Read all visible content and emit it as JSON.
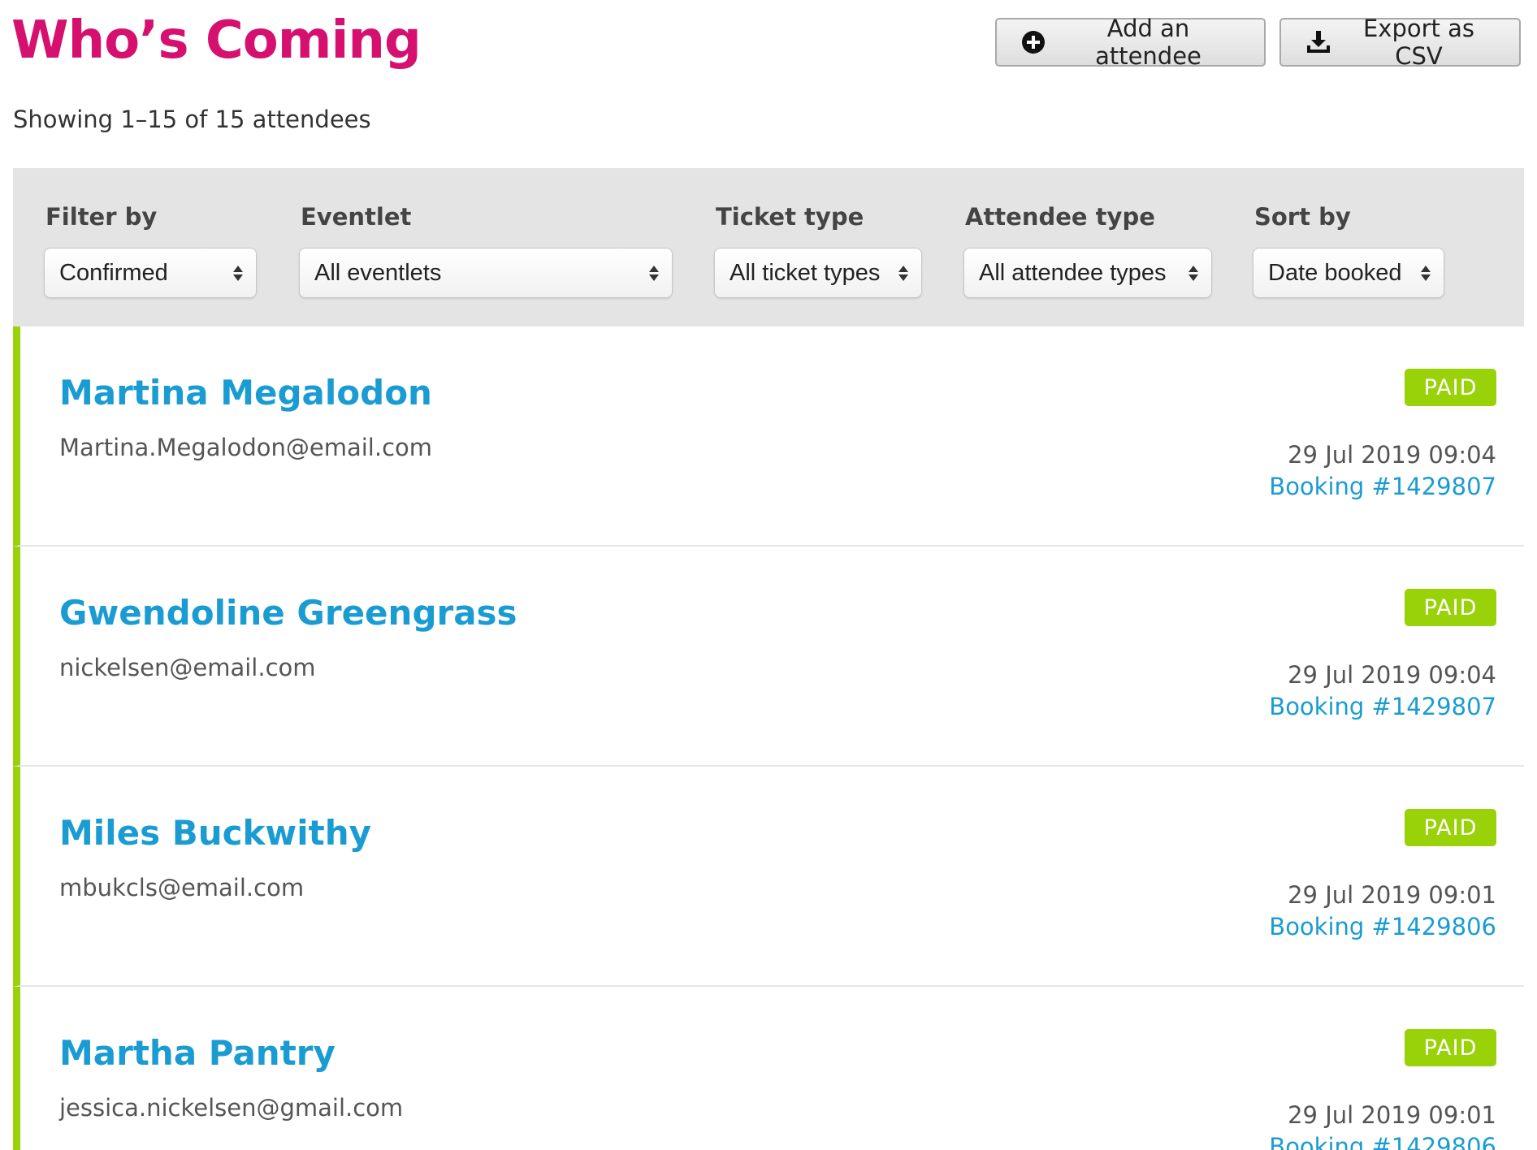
{
  "header": {
    "title": "Who’s Coming",
    "add_attendee_label": "Add an attendee",
    "export_csv_label": "Export as CSV",
    "add_icon": "plus-circle-icon",
    "export_icon": "download-icon"
  },
  "summary": {
    "showing_text": "Showing 1–15 of 15 attendees"
  },
  "filters": {
    "filter_by": {
      "label": "Filter by",
      "value": "Confirmed"
    },
    "eventlet": {
      "label": "Eventlet",
      "value": "All eventlets"
    },
    "ticket_type": {
      "label": "Ticket type",
      "value": "All ticket types"
    },
    "attendee_type": {
      "label": "Attendee type",
      "value": "All attendee types"
    },
    "sort_by": {
      "label": "Sort by",
      "value": "Date booked"
    }
  },
  "attendees": [
    {
      "name": "Martina Megalodon",
      "email": "Martina.Megalodon@email.com",
      "status": "PAID",
      "date": "29 Jul 2019 09:04",
      "booking": "Booking #1429807"
    },
    {
      "name": "Gwendoline Greengrass",
      "email": "nickelsen@email.com",
      "status": "PAID",
      "date": "29 Jul 2019 09:04",
      "booking": "Booking #1429807"
    },
    {
      "name": "Miles Buckwithy",
      "email": "mbukcls@email.com",
      "status": "PAID",
      "date": "29 Jul 2019 09:01",
      "booking": "Booking #1429806"
    },
    {
      "name": "Martha Pantry",
      "email": "jessica.nickelsen@gmail.com",
      "status": "PAID",
      "date": "29 Jul 2019 09:01",
      "booking": "Booking #1429806"
    }
  ],
  "colors": {
    "title": "#d6106e",
    "link": "#1a9cd3",
    "paid_badge": "#9ad20a",
    "row_accent": "#9ad20a",
    "filter_bar": "#e4e4e4"
  }
}
